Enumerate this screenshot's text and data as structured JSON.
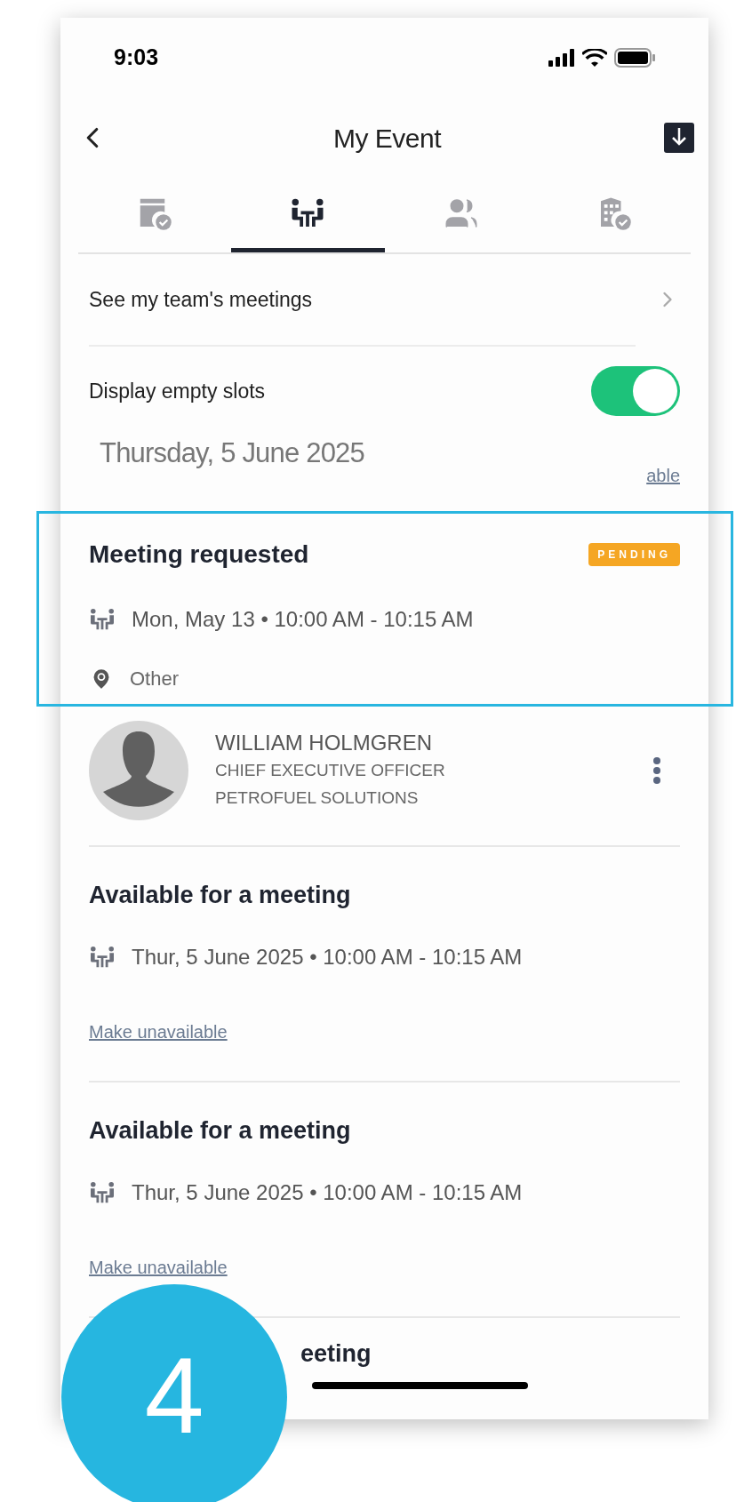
{
  "status_bar": {
    "time": "9:03"
  },
  "header": {
    "title": "My Event"
  },
  "tabs": [
    {
      "kind": "calendar",
      "selected": false
    },
    {
      "kind": "meeting",
      "selected": true
    },
    {
      "kind": "group",
      "selected": false
    },
    {
      "kind": "building",
      "selected": false
    }
  ],
  "team_link": {
    "label": "See my team's meetings"
  },
  "empty_slots": {
    "label": "Display empty slots",
    "on": true
  },
  "date_header": {
    "title": "Thursday, 5 June 2025",
    "link": "able"
  },
  "meeting": {
    "title": "Meeting requested",
    "status": "PENDING",
    "time": "Mon, May 13 • 10:00 AM - 10:15 AM",
    "location": "Other",
    "highlighted": true
  },
  "attendee": {
    "name": "WILLIAM HOLMGREN",
    "role": "CHIEF EXECUTIVE OFFICER",
    "company": "PETROFUEL SOLUTIONS"
  },
  "slots": [
    {
      "title": "Available for a meeting",
      "time": "Thur, 5 June 2025 • 10:00 AM - 10:15 AM",
      "action": "Make unavailable"
    },
    {
      "title": "Available for a meeting",
      "time": "Thur, 5 June 2025 • 10:00 AM - 10:15 AM",
      "action": "Make unavailable"
    }
  ],
  "partial_slot": {
    "title": "eeting"
  },
  "step_badge": {
    "number": "4"
  }
}
